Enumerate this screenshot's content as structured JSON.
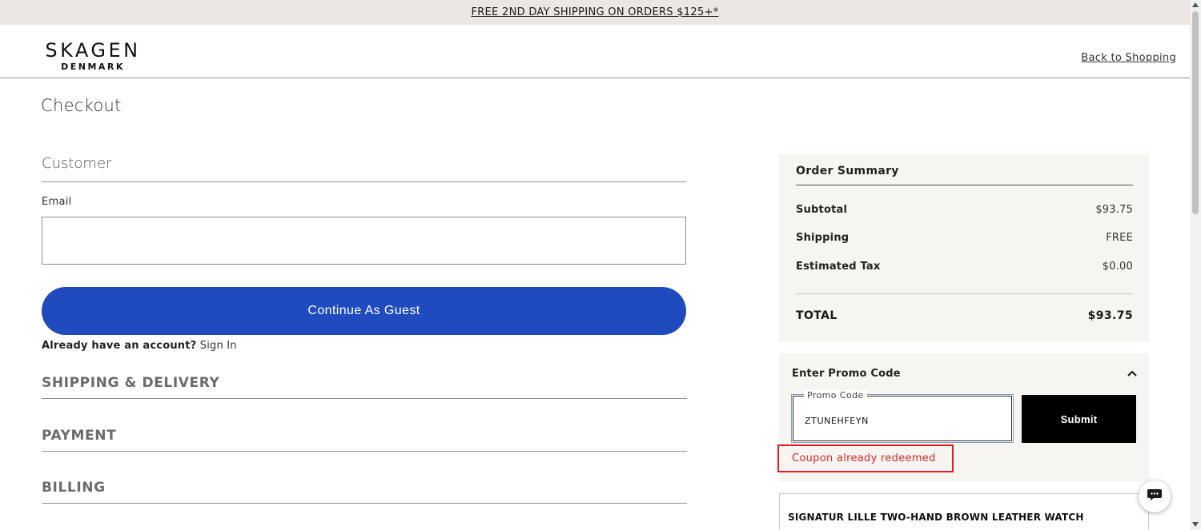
{
  "promo_bar": {
    "text": "FREE 2ND DAY SHIPPING ON ORDERS $125+*"
  },
  "header": {
    "logo_main": "SKAGEN",
    "logo_sub": "DENMARK",
    "back_link": "Back to Shopping"
  },
  "page": {
    "title": "Checkout"
  },
  "customer": {
    "heading": "Customer",
    "email_label": "Email",
    "email_value": "",
    "guest_button": "Continue As Guest",
    "account_prompt": "Already have an account?",
    "signin_link": "Sign In"
  },
  "sections": {
    "shipping": "SHIPPING & DELIVERY",
    "payment": "PAYMENT",
    "billing": "BILLING"
  },
  "order_summary": {
    "title": "Order Summary",
    "rows": [
      {
        "label": "Subtotal",
        "value": "$93.75"
      },
      {
        "label": "Shipping",
        "value": "FREE"
      },
      {
        "label": "Estimated Tax",
        "value": "$0.00"
      }
    ],
    "total_label": "TOTAL",
    "total_value": "$93.75"
  },
  "promo": {
    "title": "Enter Promo Code",
    "field_label": "Promo Code",
    "field_value": "ZTUNEHFEYN",
    "submit": "Submit",
    "error": "Coupon already redeemed",
    "expanded": true
  },
  "product": {
    "name": "SIGNATUR LILLE TWO-HAND BROWN LEATHER WATCH"
  },
  "colors": {
    "accent_blue": "#1f4bbf",
    "error_red": "#d42a2a",
    "panel_bg": "#f6f5f2",
    "promo_bar_bg": "#ebe8e3"
  },
  "icons": {
    "chevron": "chevron-up-icon",
    "chat": "chat-bubble-icon"
  }
}
